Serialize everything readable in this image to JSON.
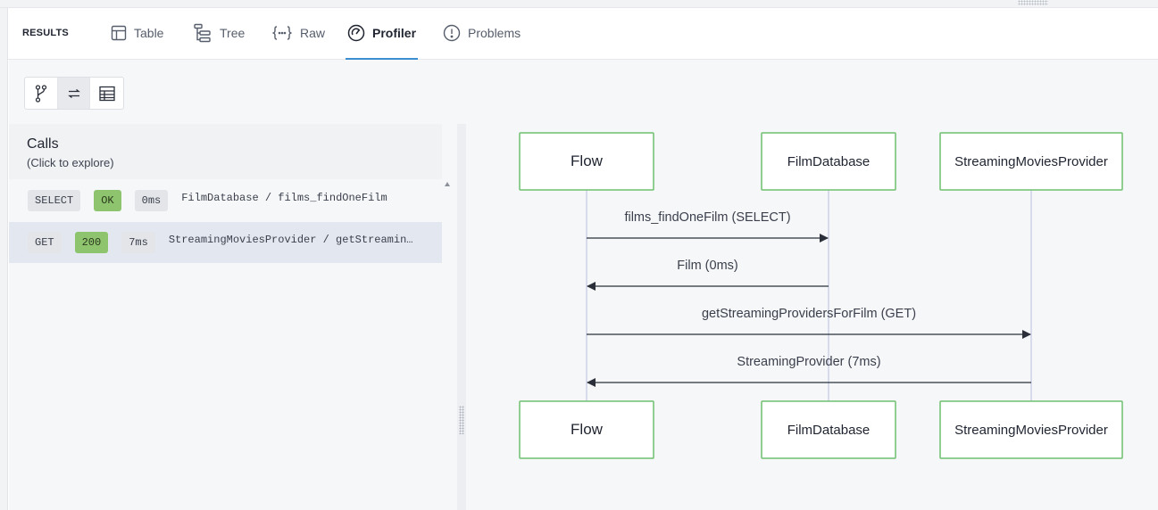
{
  "header": {
    "results_label": "RESULTS",
    "tabs": [
      {
        "label": "Table",
        "icon": "table-icon"
      },
      {
        "label": "Tree",
        "icon": "tree-icon"
      },
      {
        "label": "Raw",
        "icon": "braces-icon"
      },
      {
        "label": "Profiler",
        "icon": "gauge-icon",
        "active": true
      },
      {
        "label": "Problems",
        "icon": "alert-circle-icon"
      }
    ]
  },
  "view_toggle": {
    "options": [
      "branch-icon",
      "swap-icon",
      "grid-icon"
    ],
    "active_index": 1
  },
  "calls": {
    "title": "Calls",
    "subtitle": "(Click to explore)",
    "rows": [
      {
        "method": "SELECT",
        "status": "OK",
        "duration": "0ms",
        "path": "FilmDatabase / films_findOneFilm"
      },
      {
        "method": "GET",
        "status": "200",
        "duration": "7ms",
        "path": "StreamingMoviesProvider / getStreamingProvidersForFilm",
        "selected": true
      }
    ]
  },
  "sequence": {
    "participants": [
      "Flow",
      "FilmDatabase",
      "StreamingMoviesProvider"
    ],
    "messages": [
      {
        "label": "films_findOneFilm (SELECT)",
        "from": 0,
        "to": 1
      },
      {
        "label": "Film (0ms)",
        "from": 1,
        "to": 0
      },
      {
        "label": "getStreamingProvidersForFilm (GET)",
        "from": 0,
        "to": 2
      },
      {
        "label": "StreamingProvider (7ms)",
        "from": 2,
        "to": 0
      }
    ]
  },
  "colors": {
    "accent_underline": "#3b8fd0",
    "status_ok": "#8fc46f",
    "participant_border": "#6fbf6f",
    "selected_row": "#e3e8f0"
  }
}
